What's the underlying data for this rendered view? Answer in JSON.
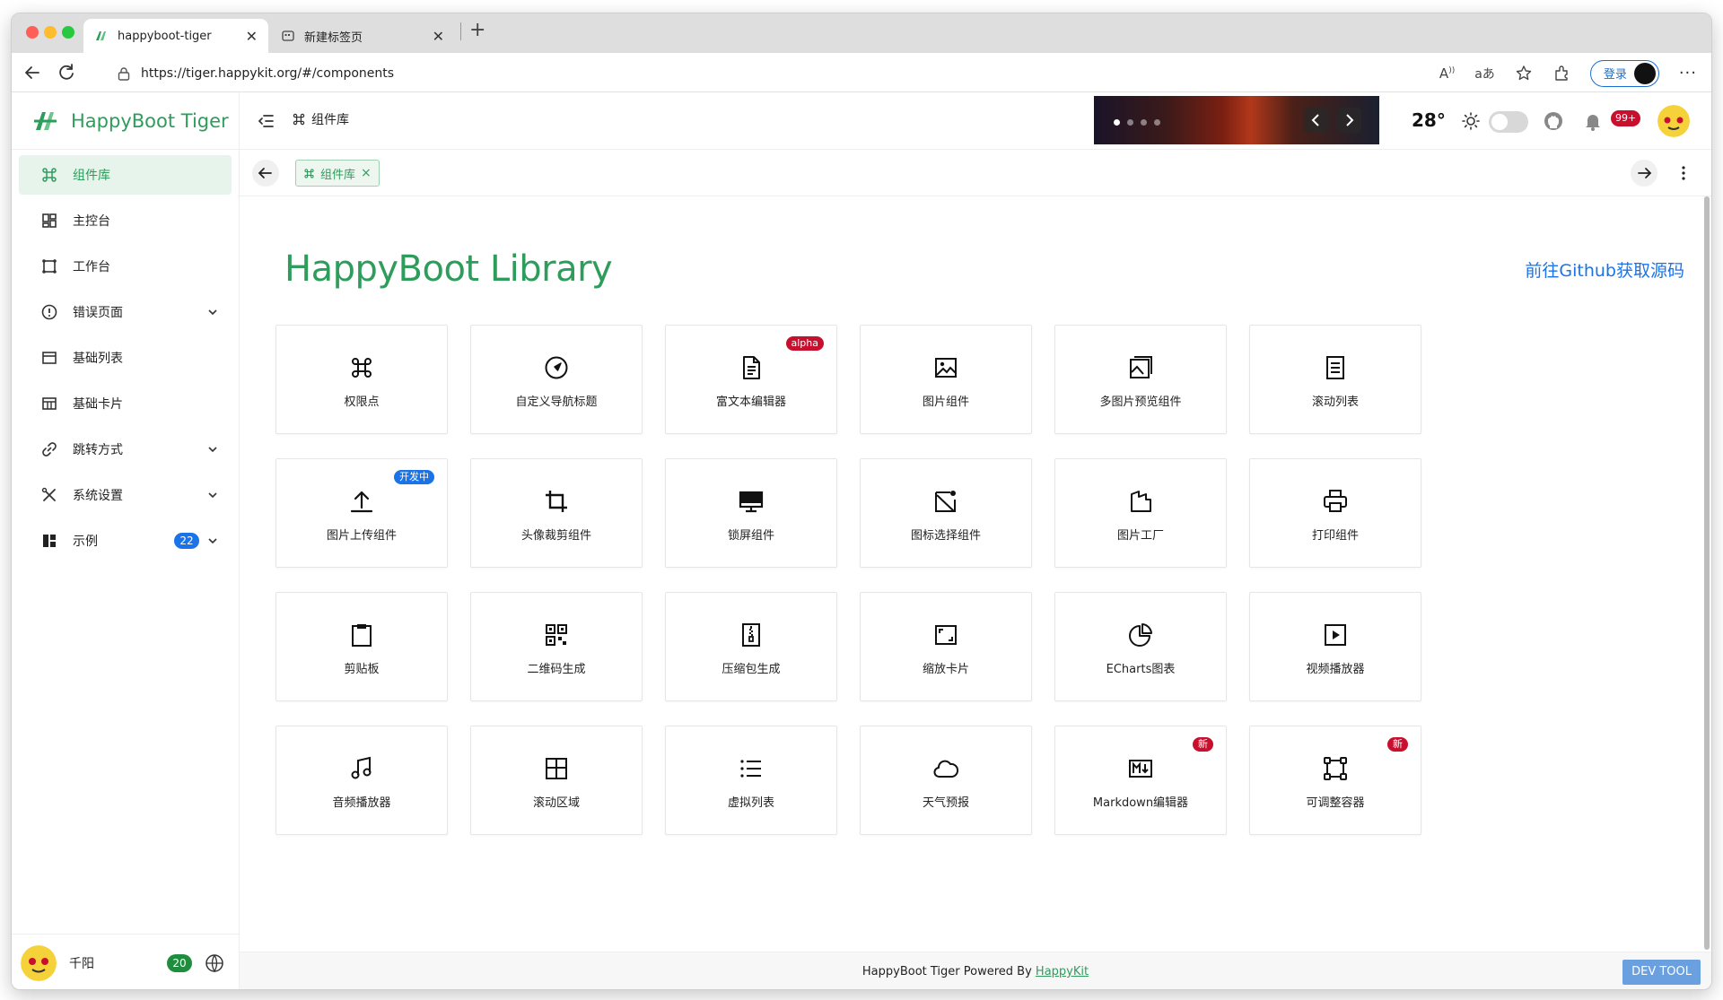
{
  "browser": {
    "tabs": [
      {
        "title": "happyboot-tiger",
        "active": true
      },
      {
        "title": "新建标签页",
        "active": false
      }
    ],
    "url": "https://tiger.happykit.org/#/components",
    "login_label": "登录",
    "new_tab_glyph": "+"
  },
  "app": {
    "logo_text": "HappyBoot Tiger",
    "brand_color": "#2e9d5c",
    "sidebar": {
      "items": [
        {
          "label": "组件库",
          "icon": "command-icon",
          "active": true
        },
        {
          "label": "主控台",
          "icon": "dashboard-icon"
        },
        {
          "label": "工作台",
          "icon": "workbench-icon"
        },
        {
          "label": "错误页面",
          "icon": "alert-circle-icon",
          "expandable": true
        },
        {
          "label": "基础列表",
          "icon": "list-card-icon"
        },
        {
          "label": "基础卡片",
          "icon": "table-icon"
        },
        {
          "label": "跳转方式",
          "icon": "link-icon",
          "expandable": true
        },
        {
          "label": "系统设置",
          "icon": "tools-icon",
          "expandable": true
        },
        {
          "label": "示例",
          "icon": "layout-icon",
          "expandable": true,
          "badge": "22"
        }
      ],
      "user": {
        "name": "千阳",
        "badge": "20"
      }
    },
    "header": {
      "breadcrumb": "组件库",
      "temperature": "28°",
      "notifications": "99+",
      "banner_slides": 4
    },
    "tags": [
      {
        "label": "组件库",
        "close": "×"
      }
    ],
    "content": {
      "title": "HappyBoot Library",
      "github_link": "前往Github获取源码",
      "cards": [
        {
          "label": "权限点",
          "icon": "command-icon"
        },
        {
          "label": "自定义导航标题",
          "icon": "compass-icon"
        },
        {
          "label": "富文本编辑器",
          "icon": "document-icon",
          "badge": "alpha",
          "badge_color": "#c8102e"
        },
        {
          "label": "图片组件",
          "icon": "image-icon"
        },
        {
          "label": "多图片预览组件",
          "icon": "images-icon"
        },
        {
          "label": "滚动列表",
          "icon": "lines-doc-icon"
        },
        {
          "label": "图片上传组件",
          "icon": "upload-icon",
          "badge": "开发中",
          "badge_color": "#1a73e8"
        },
        {
          "label": "头像裁剪组件",
          "icon": "crop-icon"
        },
        {
          "label": "锁屏组件",
          "icon": "monitor-icon"
        },
        {
          "label": "图标选择组件",
          "icon": "icon-picker-icon"
        },
        {
          "label": "图片工厂",
          "icon": "factory-icon"
        },
        {
          "label": "打印组件",
          "icon": "printer-icon"
        },
        {
          "label": "剪贴板",
          "icon": "clipboard-icon"
        },
        {
          "label": "二维码生成",
          "icon": "qrcode-icon"
        },
        {
          "label": "压缩包生成",
          "icon": "zip-icon"
        },
        {
          "label": "缩放卡片",
          "icon": "scale-icon"
        },
        {
          "label": "ECharts图表",
          "icon": "pie-chart-icon"
        },
        {
          "label": "视频播放器",
          "icon": "video-icon"
        },
        {
          "label": "音频播放器",
          "icon": "music-icon"
        },
        {
          "label": "滚动区域",
          "icon": "layout-grid-icon"
        },
        {
          "label": "虚拟列表",
          "icon": "bullet-list-icon"
        },
        {
          "label": "天气预报",
          "icon": "cloud-icon"
        },
        {
          "label": "Markdown编辑器",
          "icon": "markdown-icon",
          "badge": "新",
          "badge_color": "#c8102e"
        },
        {
          "label": "可调整容器",
          "icon": "resize-icon",
          "badge": "新",
          "badge_color": "#c8102e"
        }
      ]
    },
    "footer": {
      "text": "HappyBoot Tiger Powered By ",
      "link": "HappyKit",
      "dev_tool": "DEV TOOL"
    }
  }
}
